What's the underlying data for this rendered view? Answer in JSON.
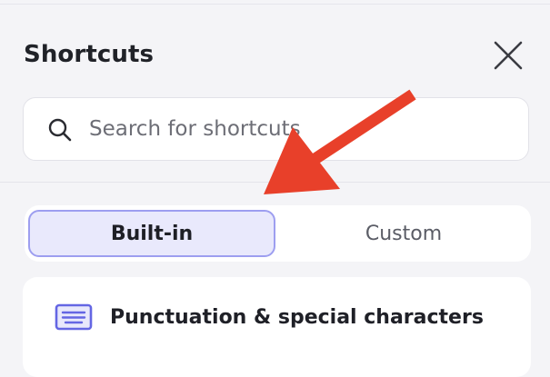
{
  "panel": {
    "title": "Shortcuts"
  },
  "search": {
    "placeholder": "Search for shortcuts",
    "value": ""
  },
  "tabs": [
    {
      "label": "Built-in",
      "selected": true
    },
    {
      "label": "Custom",
      "selected": false
    }
  ],
  "categories": [
    {
      "title": "Punctuation & special characters",
      "icon": "keyboard-icon"
    }
  ],
  "colors": {
    "accent": "#9d9ef0",
    "accent_fill": "#e9e9fc",
    "icon_accent": "#6466e3",
    "annotation_arrow": "#e8402a"
  }
}
